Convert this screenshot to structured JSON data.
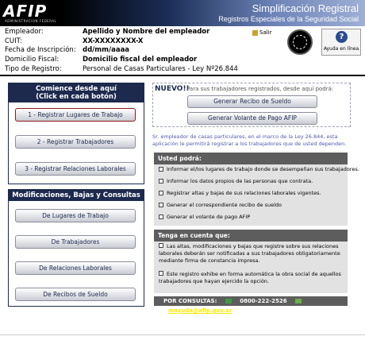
{
  "header": {
    "logo_text": "AFIP",
    "logo_sub": "ADMINISTRACION FEDERAL",
    "title": "Simplificación Registral",
    "subtitle": "Registros Especiales de la Seguridad Social"
  },
  "info": {
    "empleador_label": "Empleador:",
    "empleador_value": "Apellido y Nombre del empleador",
    "cuit_label": "CUIT:",
    "cuit_value": "XX-XXXXXXXX-X",
    "fecha_label": "Fecha de Inscripción:",
    "fecha_value": "dd/mm/aaaa",
    "domicilio_label": "Domicilio Fiscal:",
    "domicilio_value": "Domicilio fiscal del empleador",
    "tipo_label": "Tipo de Registro:",
    "tipo_value": "Personal de Casas Particulares - Ley Nº26.844",
    "salir": "Salir",
    "ayuda": "Ayuda en línea"
  },
  "left": {
    "panel1_title_1": "Comience desde aquí",
    "panel1_title_2": "(Click en cada botón)",
    "btn1": "1 - Registrar Lugares de Trabajo",
    "btn2": "2 - Registrar Trabajadores",
    "btn3": "3 - Registrar Relaciones Laborales",
    "panel2_title": "Modificaciones, Bajas y Consultas",
    "mbtn1": "De Lugares de Trabajo",
    "mbtn2": "De Trabajadores",
    "mbtn3": "De Relaciones Laborales",
    "mbtn4": "De Recibos de Sueldo"
  },
  "right": {
    "nuevo_tag": "NUEVO!!",
    "nuevo_msg": "Para sus trabajadores registrados, desde aquí podrá:",
    "btn_recibo": "Generar Recibo de Sueldo",
    "btn_volante": "Generar Volante de Pago AFIP",
    "note": "Sr. empleador de casas particulares, en el marco de la Ley 26.844, esta aplicación le permitirá registrar a los trabajadores que de usted dependen.",
    "podra_title": "Usted podrá:",
    "podra_items": [
      "Informar el/los lugares de trabajo donde se desempeñan sus trabajadores.",
      "Informar los datos propios de las personas que contrata.",
      "Registrar altas y bajas de sus relaciones laborales vigentes.",
      "Generar el correspondiente recibo de sueldo",
      "Generar el volante de pago AFIP"
    ],
    "cuenta_title": "Tenga en cuenta que:",
    "cuenta_1": "Las altas, modificaciones y bajas que registre sobre sus relaciones laborales deberán ser notificadas a sus trabajadores obligatoriamente mediante firma de constancia impresa.",
    "cuenta_2": "Este registro exhibe en forma automática la obra social de aquellos trabajadores que hayan ejercido la opción.",
    "consultas_label": "POR CONSULTAS:",
    "telefono": "0800-222-2526",
    "email": "mayuda@afip.gov.ar"
  },
  "colors": {
    "navy": "#1d2a4e",
    "gray_box": "#e2e2e2",
    "gray_head": "#5d5d5d",
    "note_blue": "#4f5cb0",
    "selected_border": "#8b1a1a"
  }
}
